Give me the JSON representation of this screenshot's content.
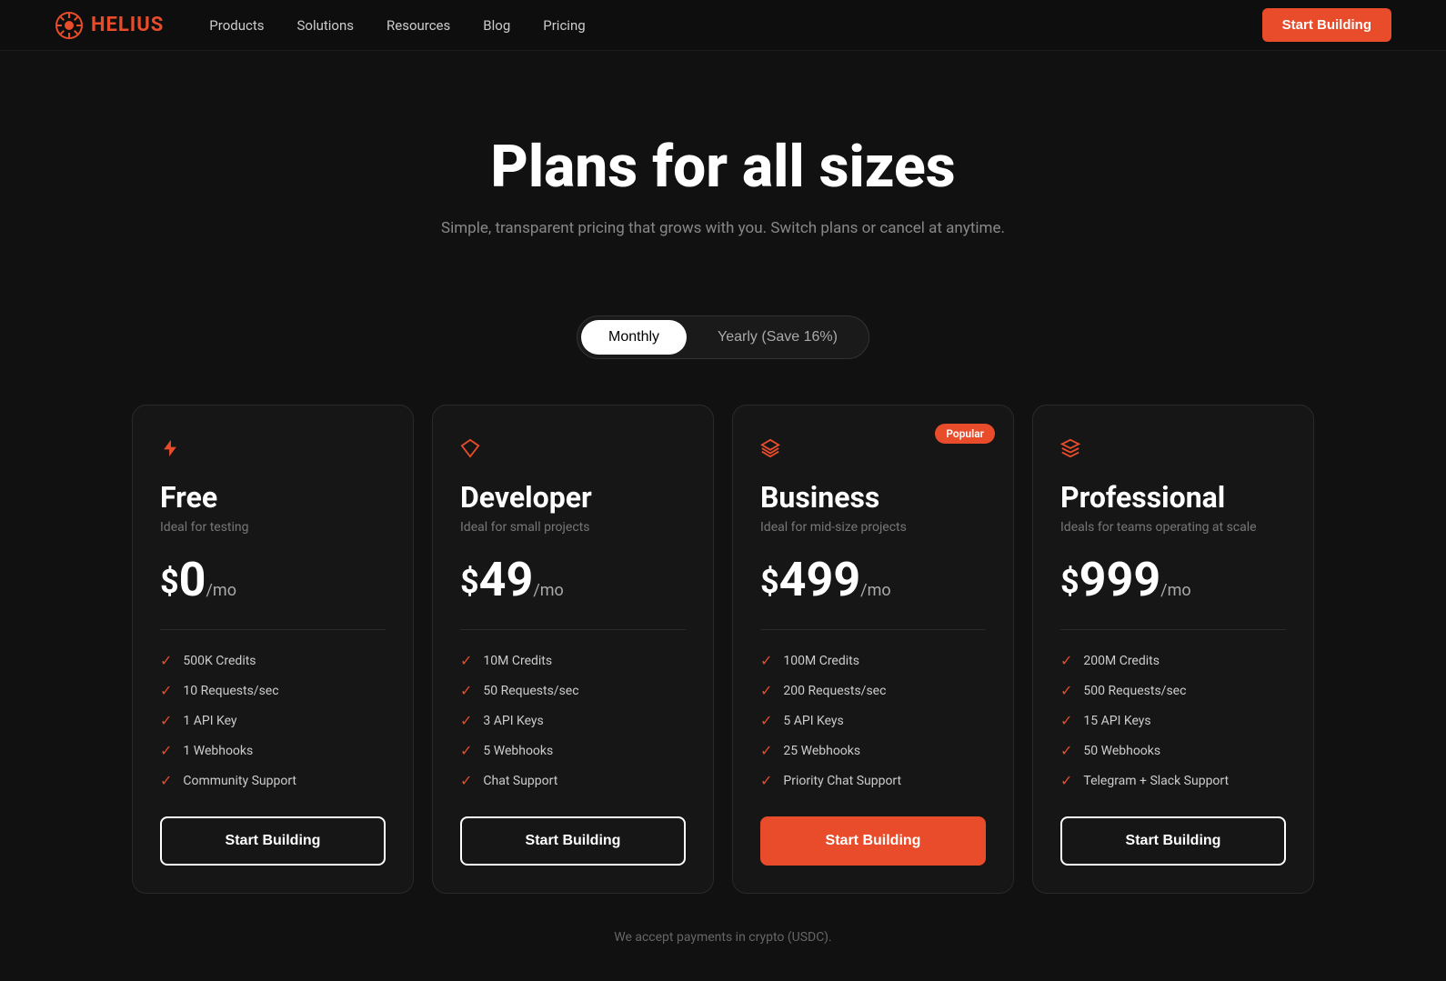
{
  "nav": {
    "logo_text": "HELIUS",
    "links": [
      "Products",
      "Solutions",
      "Resources",
      "Blog",
      "Pricing"
    ],
    "cta_label": "Start Building"
  },
  "hero": {
    "title": "Plans for all sizes",
    "subtitle": "Simple, transparent pricing that grows with you. Switch plans or cancel at anytime."
  },
  "toggle": {
    "monthly_label": "Monthly",
    "yearly_label": "Yearly (Save 16%)",
    "active": "monthly"
  },
  "plans": [
    {
      "id": "free",
      "icon": "lightning",
      "title": "Free",
      "subtitle": "Ideal for testing",
      "price": "0",
      "per_mo": "/mo",
      "dollar": "$",
      "features": [
        "500K Credits",
        "10 Requests/sec",
        "1 API Key",
        "1 Webhooks",
        "Community Support"
      ],
      "cta": "Start Building",
      "popular": false,
      "primary": false
    },
    {
      "id": "developer",
      "icon": "diamond",
      "title": "Developer",
      "subtitle": "Ideal for small projects",
      "price": "49",
      "per_mo": "/mo",
      "dollar": "$",
      "features": [
        "10M Credits",
        "50 Requests/sec",
        "3 API Keys",
        "5 Webhooks",
        "Chat Support"
      ],
      "cta": "Start Building",
      "popular": false,
      "primary": false
    },
    {
      "id": "business",
      "icon": "layers",
      "title": "Business",
      "subtitle": "Ideal for mid-size projects",
      "price": "499",
      "per_mo": "/mo",
      "dollar": "$",
      "features": [
        "100M Credits",
        "200 Requests/sec",
        "5 API Keys",
        "25 Webhooks",
        "Priority Chat Support"
      ],
      "cta": "Start Building",
      "popular": true,
      "popular_label": "Popular",
      "primary": true
    },
    {
      "id": "professional",
      "icon": "stack",
      "title": "Professional",
      "subtitle": "Ideals for teams operating at scale",
      "price": "999",
      "per_mo": "/mo",
      "dollar": "$",
      "features": [
        "200M Credits",
        "500 Requests/sec",
        "15 API Keys",
        "50 Webhooks",
        "Telegram + Slack  Support"
      ],
      "cta": "Start Building",
      "popular": false,
      "primary": false
    }
  ],
  "footer_note": "We accept payments in crypto (USDC)."
}
